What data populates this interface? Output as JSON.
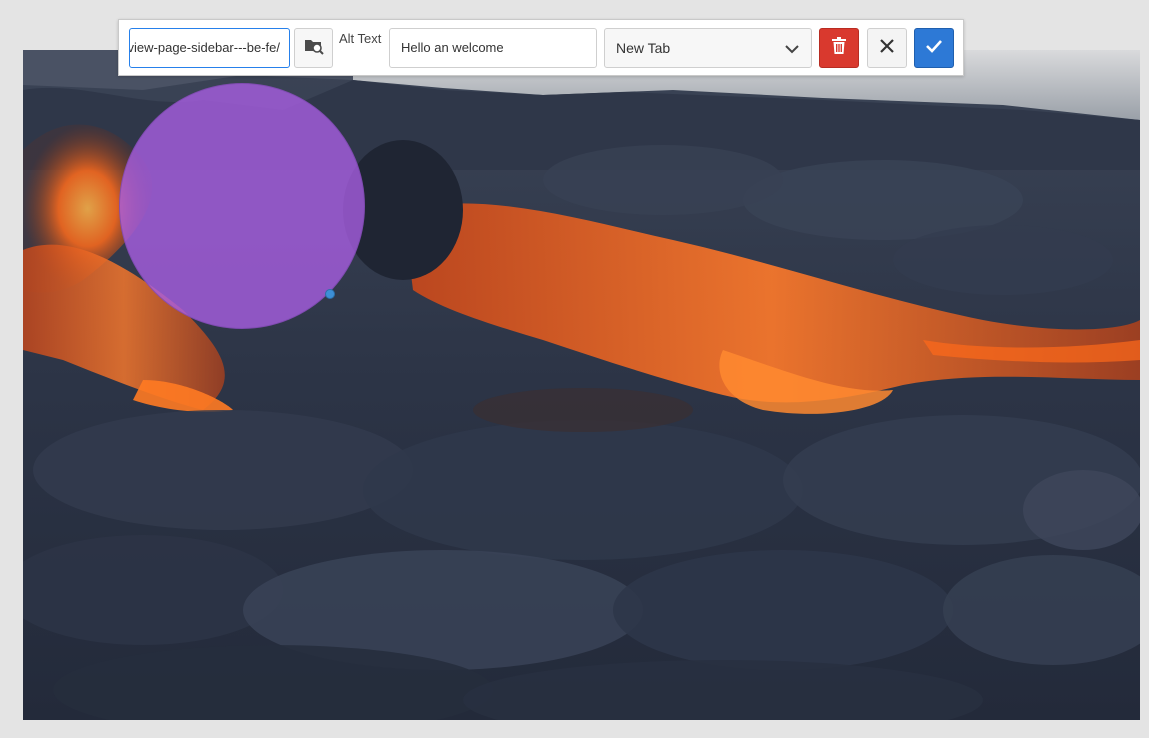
{
  "toolbar": {
    "link_value": "/content/we-retail/language-masters/en/experience/overview-page-sidebar---be-fe",
    "alt_text_label": "Alt Text",
    "alt_text_value": "Hello an welcome",
    "target_selected": "New Tab"
  },
  "icons": {
    "browse": "folder-search-icon",
    "dropdown": "chevron-down-icon",
    "delete": "trash-icon",
    "cancel": "close-icon",
    "confirm": "checkmark-icon"
  },
  "colors": {
    "accent_blue": "#2d79d6",
    "delete_red": "#d9392e",
    "hotspot_purple": "#aa5fe6",
    "focus_border": "#2680eb"
  }
}
